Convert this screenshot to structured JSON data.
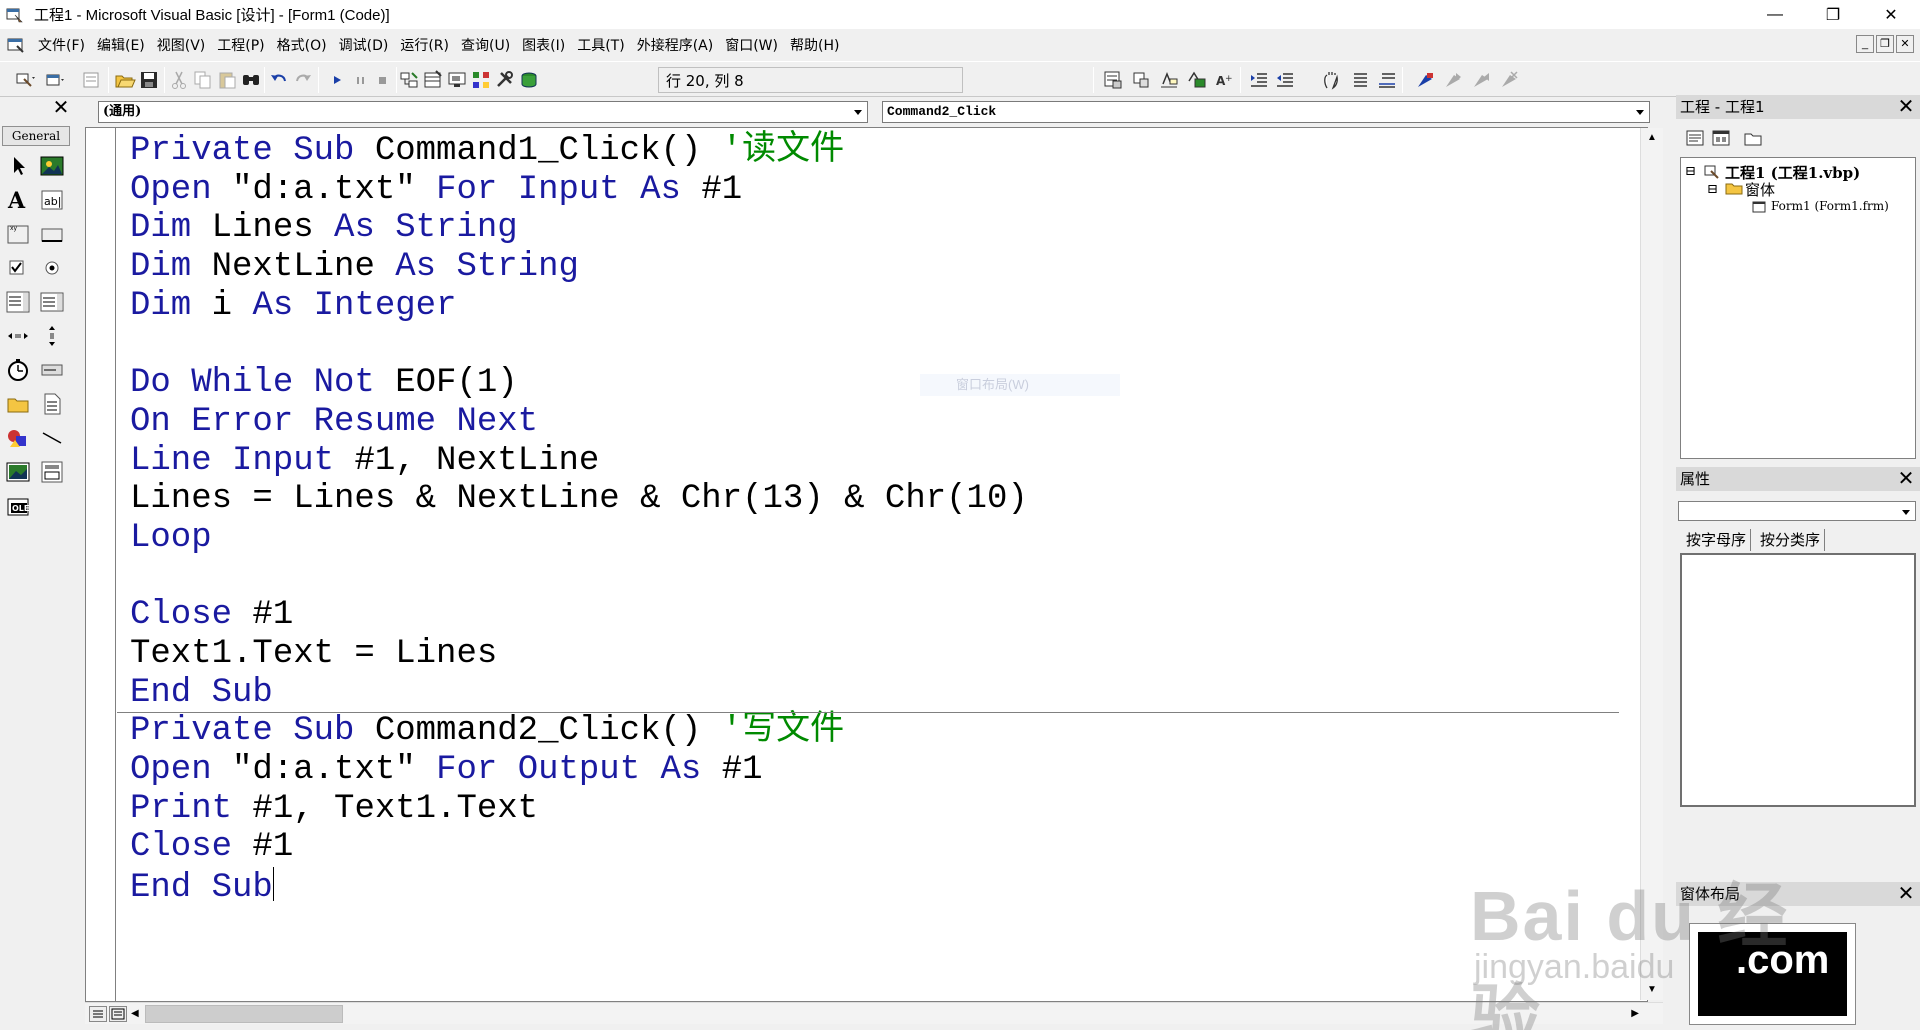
{
  "window": {
    "title": "工程1 - Microsoft Visual Basic [设计] - [Form1 (Code)]",
    "minimize": "—",
    "restore": "❐",
    "close": "✕"
  },
  "menu": {
    "items": [
      "文件(F)",
      "编辑(E)",
      "视图(V)",
      "工程(P)",
      "格式(O)",
      "调试(D)",
      "运行(R)",
      "查询(U)",
      "图表(I)",
      "工具(T)",
      "外接程序(A)",
      "窗口(W)",
      "帮助(H)"
    ],
    "mdi_min": "_",
    "mdi_restore": "❐",
    "mdi_close": "✕"
  },
  "toolbar": {
    "position_readout": "行 20, 列 8"
  },
  "toolbox": {
    "tab_label": "General",
    "close": "✕"
  },
  "code_window": {
    "object_combo": "(通用)",
    "procedure_combo": "Command2_Click",
    "lines": [
      [
        {
          "t": "Private Sub ",
          "c": "kw"
        },
        {
          "t": "Command1_Click() ",
          "c": "tx"
        },
        {
          "t": "'读文件",
          "c": "cm"
        }
      ],
      [
        {
          "t": "Open ",
          "c": "kw"
        },
        {
          "t": "\"d:a.txt\" ",
          "c": "tx"
        },
        {
          "t": "For Input As ",
          "c": "kw"
        },
        {
          "t": "#1",
          "c": "tx"
        }
      ],
      [
        {
          "t": "Dim ",
          "c": "kw"
        },
        {
          "t": "Lines ",
          "c": "tx"
        },
        {
          "t": "As String",
          "c": "kw"
        }
      ],
      [
        {
          "t": "Dim ",
          "c": "kw"
        },
        {
          "t": "NextLine ",
          "c": "tx"
        },
        {
          "t": "As String",
          "c": "kw"
        }
      ],
      [
        {
          "t": "Dim ",
          "c": "kw"
        },
        {
          "t": "i ",
          "c": "tx"
        },
        {
          "t": "As Integer",
          "c": "kw"
        }
      ],
      [],
      [
        {
          "t": "Do While Not ",
          "c": "kw"
        },
        {
          "t": "EOF(1)",
          "c": "tx"
        }
      ],
      [
        {
          "t": "On Error Resume Next",
          "c": "kw"
        }
      ],
      [
        {
          "t": "Line Input ",
          "c": "kw"
        },
        {
          "t": "#1, NextLine",
          "c": "tx"
        }
      ],
      [
        {
          "t": "Lines = Lines & NextLine & Chr(13) & Chr(10)",
          "c": "tx"
        }
      ],
      [
        {
          "t": "Loop",
          "c": "kw"
        }
      ],
      [],
      [
        {
          "t": "Close ",
          "c": "kw"
        },
        {
          "t": "#1",
          "c": "tx"
        }
      ],
      [
        {
          "t": "Text1.Text = Lines",
          "c": "tx"
        }
      ],
      [
        {
          "t": "End Sub",
          "c": "kw"
        }
      ],
      [
        {
          "t": "Private Sub ",
          "c": "kw"
        },
        {
          "t": "Command2_Click() ",
          "c": "tx"
        },
        {
          "t": "'写文件",
          "c": "cm"
        }
      ],
      [
        {
          "t": "Open ",
          "c": "kw"
        },
        {
          "t": "\"d:a.txt\" ",
          "c": "tx"
        },
        {
          "t": "For Output As ",
          "c": "kw"
        },
        {
          "t": "#1",
          "c": "tx"
        }
      ],
      [
        {
          "t": "Print ",
          "c": "kw"
        },
        {
          "t": "#1, Text1.Text",
          "c": "tx"
        }
      ],
      [
        {
          "t": "Close ",
          "c": "kw"
        },
        {
          "t": "#1",
          "c": "tx"
        }
      ],
      [
        {
          "t": "End Sub",
          "c": "kw"
        }
      ]
    ]
  },
  "project_panel": {
    "title": "工程 - 工程1",
    "close": "✕",
    "tree": {
      "project": "工程1 (工程1.vbp)",
      "folder": "窗体",
      "form": "Form1 (Form1.frm)"
    }
  },
  "properties_panel": {
    "title": "属性",
    "close": "✕",
    "tabs": [
      "按字母序",
      "按分类序"
    ]
  },
  "layout_panel": {
    "title": "窗体布局",
    "close": "✕"
  },
  "watermark": {
    "main": "Bai du 经验",
    "sub": "jingyan.baidu",
    "com": ".com"
  },
  "tooltip_faint": "窗口布局(W)",
  "colors": {
    "keyword": "#1a1aa0",
    "comment": "#008a00",
    "text": "#000000"
  }
}
